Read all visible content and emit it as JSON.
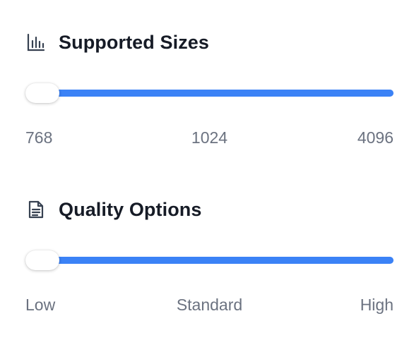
{
  "colors": {
    "accent": "#3b82f6",
    "title": "#161b26",
    "label": "#6b7280",
    "icon": "#374151"
  },
  "supported_sizes": {
    "icon": "bar-chart-icon",
    "title": "Supported Sizes",
    "slider": {
      "value_fraction": 0.0
    },
    "labels": [
      "768",
      "1024",
      "4096"
    ]
  },
  "quality_options": {
    "icon": "document-icon",
    "title": "Quality Options",
    "slider": {
      "value_fraction": 0.0
    },
    "labels": [
      "Low",
      "Standard",
      "High"
    ]
  }
}
